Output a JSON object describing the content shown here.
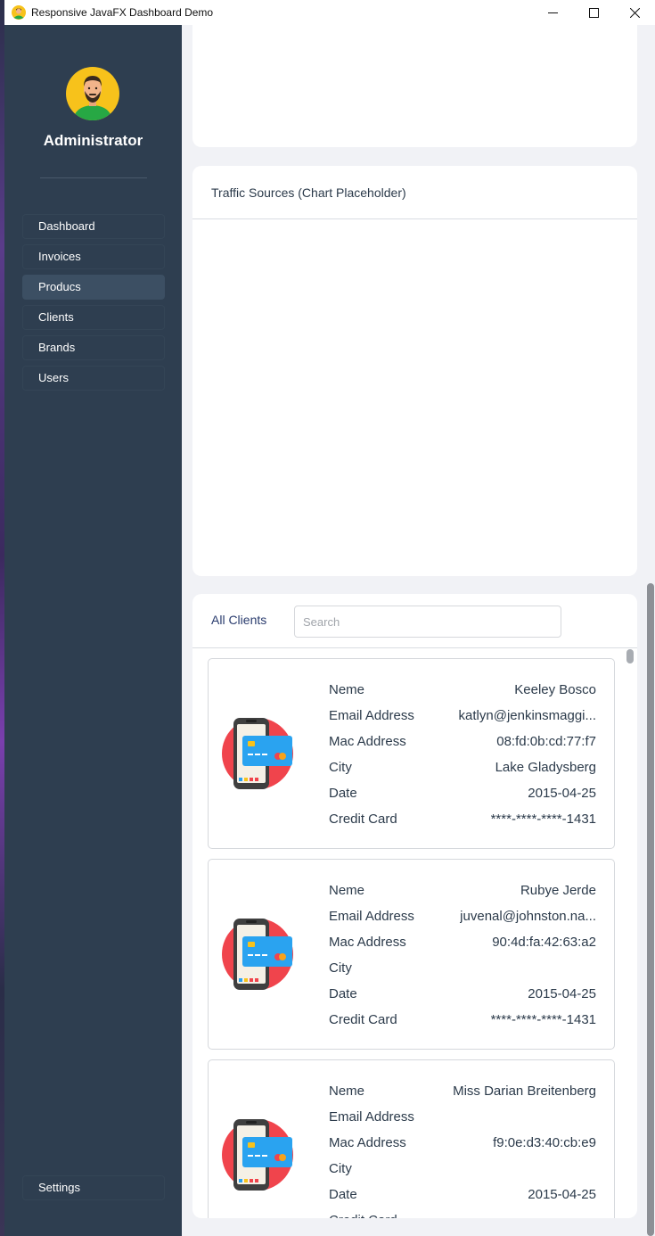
{
  "window": {
    "title": "Responsive JavaFX Dashboard Demo"
  },
  "sidebar": {
    "user_name": "Administrator",
    "items": [
      {
        "label": "Dashboard",
        "active": false
      },
      {
        "label": "Invoices",
        "active": false
      },
      {
        "label": "Producs",
        "active": true
      },
      {
        "label": "Clients",
        "active": false
      },
      {
        "label": "Brands",
        "active": false
      },
      {
        "label": "Users",
        "active": false
      }
    ],
    "settings_label": "Settings"
  },
  "traffic": {
    "title": "Traffic Sources (Chart Placeholder)"
  },
  "clients": {
    "title": "All Clients",
    "search_placeholder": "Search",
    "labels": {
      "name": "Neme",
      "email": "Email Address",
      "mac": "Mac Address",
      "city": "City",
      "date": "Date",
      "card": "Credit Card"
    },
    "list": [
      {
        "name": "Keeley Bosco",
        "email": "katlyn@jenkinsmaggi...",
        "mac": "08:fd:0b:cd:77:f7",
        "city": "Lake Gladysberg",
        "date": "2015-04-25",
        "card": "****-****-****-1431"
      },
      {
        "name": "Rubye Jerde",
        "email": "juvenal@johnston.na...",
        "mac": "90:4d:fa:42:63:a2",
        "city": "",
        "date": "2015-04-25",
        "card": "****-****-****-1431"
      },
      {
        "name": "Miss Darian Breitenberg",
        "email": "",
        "mac": "f9:0e:d3:40:cb:e9",
        "city": "",
        "date": "2015-04-25",
        "card": ""
      }
    ]
  },
  "colors": {
    "sidebar_bg": "#2e3e50",
    "page_bg": "#f1f2f6",
    "accent_red": "#f0444c",
    "card_blue": "#2aa3f0"
  }
}
